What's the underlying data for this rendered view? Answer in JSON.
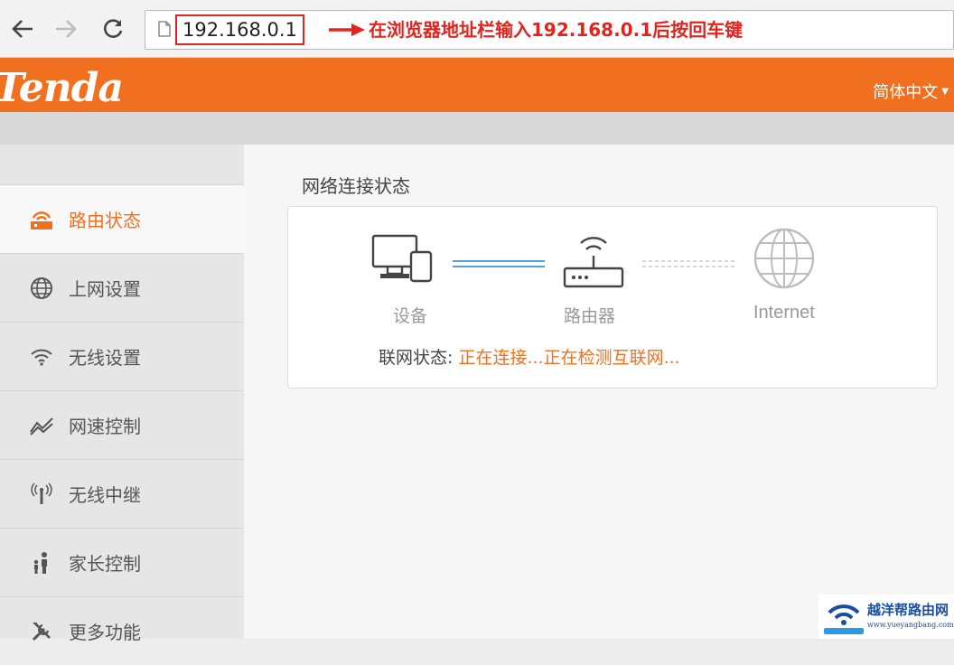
{
  "browser": {
    "url": "192.168.0.1",
    "annotation": "在浏览器地址栏输入192.168.0.1后按回车键"
  },
  "header": {
    "logo": "Tenda",
    "language": "简体中文",
    "brand_color": "#f07020"
  },
  "sidebar": {
    "items": [
      {
        "label": "路由状态",
        "icon": "router-status-icon",
        "active": true
      },
      {
        "label": "上网设置",
        "icon": "globe-icon",
        "active": false
      },
      {
        "label": "无线设置",
        "icon": "wifi-icon",
        "active": false
      },
      {
        "label": "网速控制",
        "icon": "speed-chart-icon",
        "active": false
      },
      {
        "label": "无线中继",
        "icon": "antenna-icon",
        "active": false
      },
      {
        "label": "家长控制",
        "icon": "parent-child-icon",
        "active": false
      },
      {
        "label": "更多功能",
        "icon": "tools-icon",
        "active": false
      }
    ]
  },
  "main": {
    "section_title": "网络连接状态",
    "nodes": {
      "device": "设备",
      "router": "路由器",
      "internet": "Internet"
    },
    "status_label": "联网状态:",
    "status_value": "正在连接...正在检测互联网..."
  },
  "watermark": {
    "title": "越洋帮路由网",
    "subtitle": "www.yueyangbang.com"
  }
}
